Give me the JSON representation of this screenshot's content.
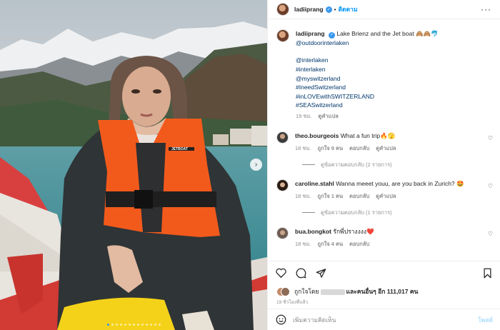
{
  "header": {
    "username": "ladiiprang",
    "separator": "•",
    "follow_label": "ติดตาม",
    "more_icon": "more-horizontal-icon"
  },
  "caption": {
    "username": "ladiiprang",
    "text": "Lake Brienz and the Jet boat 🙈🙈🐬",
    "mention": "@outdoorinterlaken",
    "tags": [
      "@interlaken",
      "#interlaken",
      "@myswitzerland",
      "#IneedSwitzerland",
      "#inLOVEwithSWITZERLAND",
      "#SEASwitzerland"
    ],
    "time": "19 ชม.",
    "translate": "ดูคำแปล"
  },
  "comments": [
    {
      "username": "theo.bourgeois",
      "text": "What a fun trip🔥🫣",
      "time": "18 ชม.",
      "likes": "ถูกใจ 9 คน",
      "reply": "ตอบกลับ",
      "translate": "ดูคำแปล",
      "view_replies": "ดูข้อความตอบกลับ (2 รายการ)"
    },
    {
      "username": "caroline.stahl",
      "text": "Wanna meeet youu, are you back in Zurich? 🤩",
      "time": "18 ชม.",
      "likes": "ถูกใจ 1 คน",
      "reply": "ตอบกลับ",
      "translate": "ดูคำแปล",
      "view_replies": "ดูข้อความตอบกลับ (1 รายการ)"
    },
    {
      "username": "bua.bongkot",
      "text": "รักพี่ปรางงงง❤️",
      "time": "18 ชม.",
      "likes": "ถูกใจ 4 คน",
      "reply": "ตอบกลับ"
    }
  ],
  "likes_summary": {
    "prefix": "ถูกใจโดย",
    "suffix": "และคนอื่นๆ อีก 111,017 คน"
  },
  "posted_ago": "19 ชั่วโมงที่แล้ว",
  "add_comment": {
    "placeholder": "เพิ่มความคิดเห็น",
    "post_label": "โพสต์"
  },
  "carousel": {
    "total": 13,
    "active": 0
  },
  "colors": {
    "accent": "#0095f6",
    "vest": "#f25a1c",
    "verified": "#3797f0"
  }
}
